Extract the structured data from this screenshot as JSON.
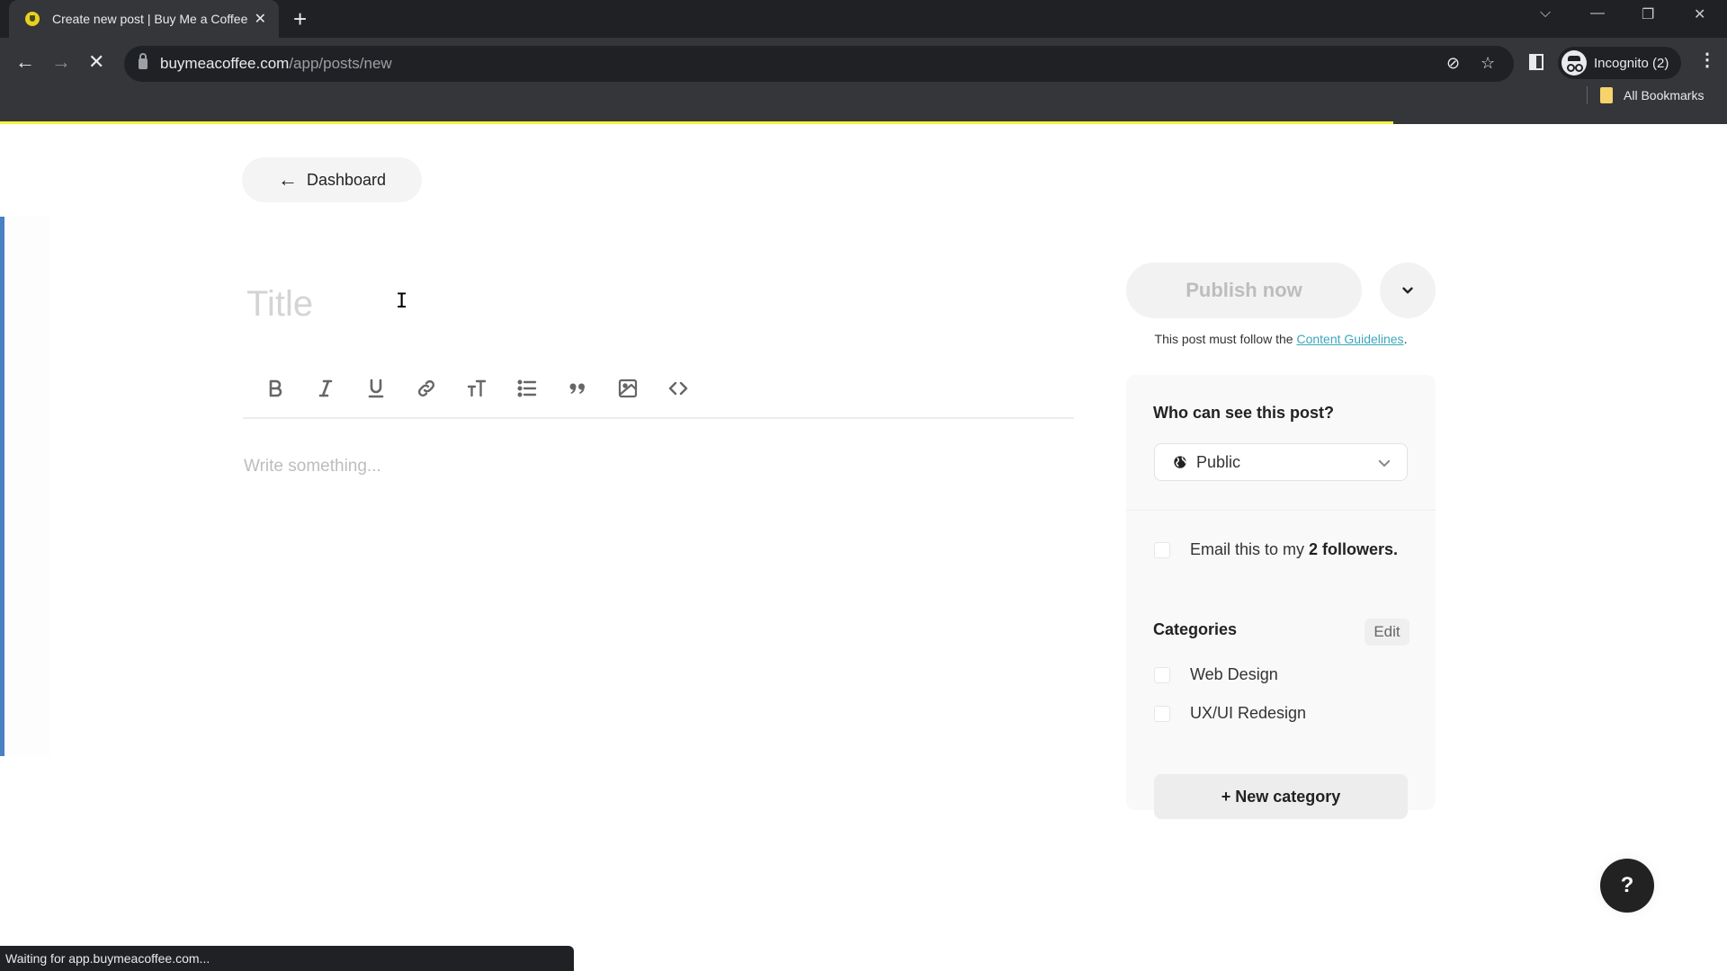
{
  "browser": {
    "tab_title": "Create new post | Buy Me a Coffee",
    "new_tab_symbol": "+",
    "tab_close_symbol": "✕",
    "url_host": "buymeacoffee.com",
    "url_path": "/app/posts/new",
    "profile_label": "Incognito (2)",
    "bookmarks_label": "All Bookmarks",
    "page_load_progress_percent": 80.7,
    "status_text": "Waiting for app.buymeacoffee.com...",
    "icons": {
      "back": "←",
      "forward": "→",
      "stop": "✕",
      "eye_off": "⊘",
      "star": "☆",
      "tab_search": "⌵",
      "minimize": "—",
      "restore": "❐",
      "close": "✕",
      "menu": "⋮"
    }
  },
  "page": {
    "back_button_label": "Dashboard",
    "back_arrow": "←",
    "title_placeholder": "Title",
    "text_cursor_glyph": "I",
    "body_placeholder": "Write something...",
    "editor_toolbar": [
      {
        "name": "bold",
        "tooltip": "Bold"
      },
      {
        "name": "italic",
        "tooltip": "Italic"
      },
      {
        "name": "underline",
        "tooltip": "Underline"
      },
      {
        "name": "link",
        "tooltip": "Link"
      },
      {
        "name": "text-size",
        "tooltip": "Text size"
      },
      {
        "name": "bulleted-list",
        "tooltip": "List"
      },
      {
        "name": "quote",
        "tooltip": "Quote"
      },
      {
        "name": "image",
        "tooltip": "Image"
      },
      {
        "name": "code",
        "tooltip": "Code"
      }
    ]
  },
  "sidebar": {
    "publish_label": "Publish now",
    "guidelines_prefix": "This post must follow the ",
    "guidelines_link": "Content Guidelines",
    "guidelines_suffix": ".",
    "visibility_heading": "Who can see this post?",
    "visibility_value": "Public",
    "email_label_prefix": "Email this to my ",
    "email_label_bold": "2 followers.",
    "email_checked": false,
    "categories_heading": "Categories",
    "edit_label": "Edit",
    "categories": [
      {
        "label": "Web Design",
        "checked": false
      },
      {
        "label": "UX/UI Redesign",
        "checked": false
      }
    ],
    "new_category_label": "+ New category"
  },
  "help": {
    "label": "?"
  },
  "colors": {
    "accent_link": "#3aa7bd",
    "progress_yellow": "#f5f044",
    "left_accent_blue": "#4a80c4"
  }
}
